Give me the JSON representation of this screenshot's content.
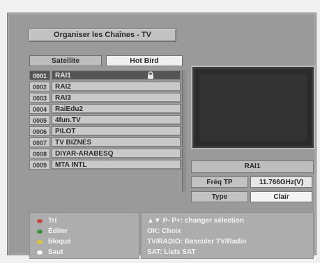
{
  "header": {
    "title": "Organiser les Chaînes - TV"
  },
  "tabs": [
    {
      "label": "Satellite",
      "active": false
    },
    {
      "label": "Hot Bird",
      "active": true
    }
  ],
  "channels": [
    {
      "num": "0001",
      "name": "RAI1",
      "locked": true,
      "selected": true
    },
    {
      "num": "0002",
      "name": "RAI2",
      "locked": false,
      "selected": false
    },
    {
      "num": "0003",
      "name": "RAI3",
      "locked": false,
      "selected": false
    },
    {
      "num": "0004",
      "name": "RaiEdu2",
      "locked": false,
      "selected": false
    },
    {
      "num": "0005",
      "name": "4fun.TV",
      "locked": false,
      "selected": false
    },
    {
      "num": "0006",
      "name": "PILOT",
      "locked": false,
      "selected": false
    },
    {
      "num": "0007",
      "name": "TV BIZNES",
      "locked": false,
      "selected": false
    },
    {
      "num": "0008",
      "name": "DIYAR-ARABESQ",
      "locked": false,
      "selected": false
    },
    {
      "num": "0009",
      "name": "MTA INTL",
      "locked": false,
      "selected": false
    }
  ],
  "info": {
    "channel_name": "RAI1",
    "freq_label": "Fréq TP",
    "freq_value": "11.766GHz(V)",
    "type_label": "Type",
    "type_value": "Clair"
  },
  "legend": [
    {
      "label": "Tri",
      "color": "#c4463f"
    },
    {
      "label": "Éditer",
      "color": "#3f8f3a"
    },
    {
      "label": "bloqué",
      "color": "#d9c43a"
    },
    {
      "label": "Saut",
      "color": "#ffffff"
    }
  ],
  "help": [
    "▲▼ P- P+: changer sélection",
    "OK: Choix",
    "TV/RADIO: Basculer TV/Radio",
    "SAT: Lists SAT"
  ]
}
